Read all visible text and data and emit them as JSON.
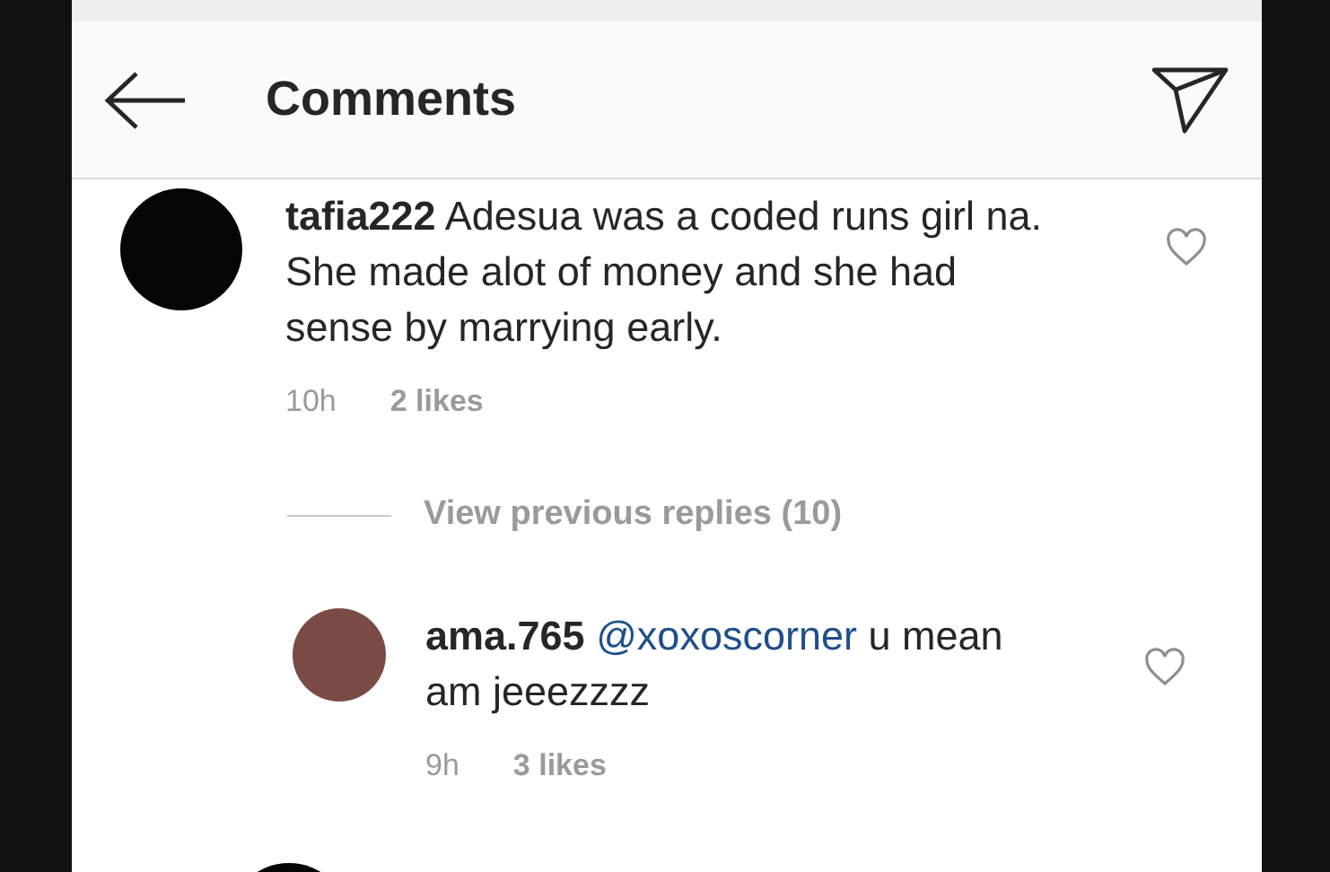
{
  "header": {
    "title": "Comments"
  },
  "comments": [
    {
      "username": "tafia222",
      "text": "Adesua was a coded runs girl na. She made alot of money and she had sense by marrying early.",
      "time": "10h",
      "likes": "2 likes",
      "liked": false,
      "kind": "dark-logo",
      "replies_link": "View previous replies (10)",
      "replies": [
        {
          "username": "ama.765",
          "mention": "@xoxoscorner",
          "text": "u mean am jeeezzzz",
          "time": "9h",
          "likes": "3 likes",
          "liked": false,
          "kind": "photo"
        }
      ]
    }
  ]
}
